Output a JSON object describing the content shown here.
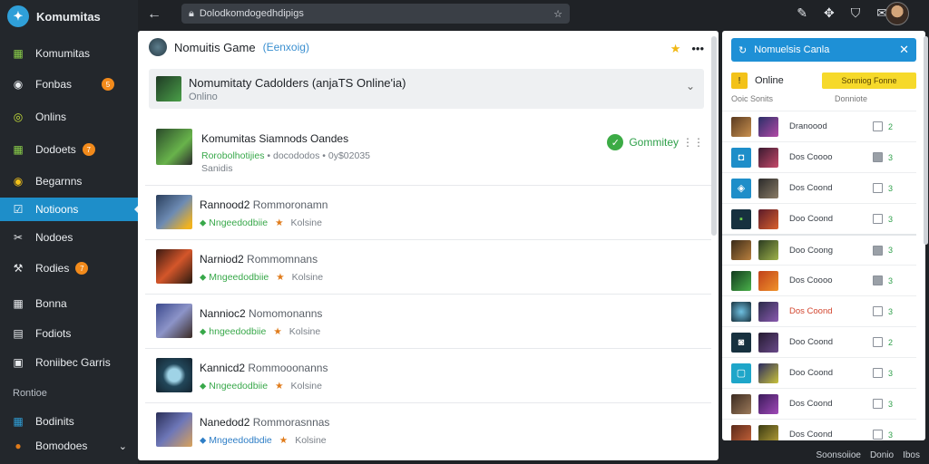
{
  "app": {
    "title": "Komumitas"
  },
  "sidebar": {
    "items": [
      {
        "label": "Komumitas",
        "icon": "chart-icon",
        "active": false,
        "badge": ""
      },
      {
        "label": "Fonbas",
        "icon": "disc-icon",
        "active": false,
        "badge": "5"
      },
      {
        "label": "Onlins",
        "icon": "circle-icon",
        "active": false,
        "badge": ""
      },
      {
        "label": "Dodoets",
        "icon": "chart-icon",
        "active": false,
        "badge": "7"
      },
      {
        "label": "Begarnns",
        "icon": "disc-icon",
        "active": false,
        "badge": ""
      },
      {
        "label": "Notioons",
        "icon": "check-square-icon",
        "active": true,
        "badge": ""
      },
      {
        "label": "Nodoes",
        "icon": "tools-icon",
        "active": false,
        "badge": ""
      },
      {
        "label": "Rodies",
        "icon": "wrench-icon",
        "active": false,
        "badge": "7"
      },
      {
        "label": "Bonna",
        "icon": "grid-icon",
        "active": false,
        "badge": ""
      },
      {
        "label": "Fodiots",
        "icon": "doc-icon",
        "active": false,
        "badge": ""
      },
      {
        "label": "Roniibec Garris",
        "icon": "image-icon",
        "active": false,
        "badge": ""
      }
    ],
    "section_title": "Rontioe",
    "section_items": [
      {
        "label": "Bodinits",
        "icon": "chart-icon"
      },
      {
        "label": "Bomodoes",
        "icon": "disc-icon"
      }
    ]
  },
  "topbar": {
    "url": "Dolodkomdogedhdipigs"
  },
  "main": {
    "header_title": "Nomuitis Game",
    "header_tag": "(Eenxoig)",
    "group_title": "Nomumitaty Cadolders (anjaTS Online'ia)",
    "group_sub": "Onlino",
    "feature": {
      "title": "Komumitas Siamnods Oandes",
      "meta_green": "Rorobolhotijies",
      "meta_rest": "• docododos • 0y$02035",
      "line3": "Sanidis",
      "status": "Gommitey"
    },
    "rows": [
      {
        "title": "Rannood2",
        "subtitle": "Rommoronamn",
        "tag": "Nngeedodbiie",
        "mode": "Kolsine"
      },
      {
        "title": "Narniod2",
        "subtitle": "Rommomnans",
        "tag": "Mngeedodbiie",
        "mode": "Kolsine"
      },
      {
        "title": "Nannioc2",
        "subtitle": "Nomomonanns",
        "tag": "hngeedodbiie",
        "mode": "Kolsine"
      },
      {
        "title": "Kannicd2",
        "subtitle": "Rommooonanns",
        "tag": "Nngeedodbiie",
        "mode": "Kolsine"
      },
      {
        "title": "Nanedod2",
        "subtitle": "Rommorasnnas",
        "tag": "Mngeedodbdie",
        "mode": "Kolsine"
      }
    ]
  },
  "right": {
    "header": "Nomuelsis Canla",
    "online_label": "Online",
    "join_label": "Sonniog Fonne",
    "sub_left": "Ooic Sonits",
    "sub_right": "Donniote",
    "rows": [
      {
        "name": "Dranoood",
        "checked": false,
        "num": "2"
      },
      {
        "name": "Dos Coooo",
        "checked": true,
        "num": "3"
      },
      {
        "name": "Dos Coond",
        "checked": false,
        "num": "3"
      },
      {
        "name": "Doo Coond",
        "checked": false,
        "num": "3"
      },
      {
        "name": "Doo Coong",
        "checked": true,
        "num": "3"
      },
      {
        "name": "Dos Coooo",
        "checked": true,
        "num": "3"
      },
      {
        "name": "Dos Coond",
        "checked": false,
        "num": "3"
      },
      {
        "name": "Doo Coond",
        "checked": false,
        "num": "2"
      },
      {
        "name": "Doo Coond",
        "checked": false,
        "num": "3"
      },
      {
        "name": "Dos Coond",
        "checked": false,
        "num": "3"
      },
      {
        "name": "Dos Coond",
        "checked": false,
        "num": "3"
      }
    ]
  },
  "footer": {
    "items": [
      "Soonsoiioe",
      "Donio",
      "Ibos"
    ]
  }
}
